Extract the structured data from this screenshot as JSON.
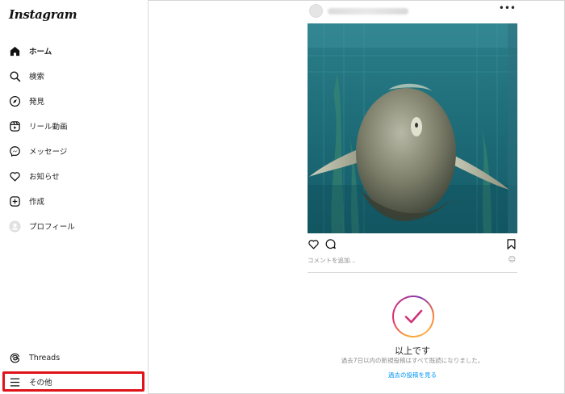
{
  "app": {
    "logo_text": "Instagram"
  },
  "sidebar": {
    "items": [
      {
        "label": "ホーム",
        "icon": "home-icon",
        "active": true
      },
      {
        "label": "検索",
        "icon": "search-icon"
      },
      {
        "label": "発見",
        "icon": "compass-icon"
      },
      {
        "label": "リール動画",
        "icon": "reels-icon"
      },
      {
        "label": "メッセージ",
        "icon": "messenger-icon"
      },
      {
        "label": "お知らせ",
        "icon": "heart-icon"
      },
      {
        "label": "作成",
        "icon": "plus-square-icon"
      },
      {
        "label": "プロフィール",
        "icon": "avatar-icon"
      }
    ],
    "threads": {
      "label": "Threads",
      "icon": "threads-icon"
    },
    "more": {
      "label": "その他",
      "icon": "hamburger-menu-icon",
      "highlight_color": "#e0131a"
    }
  },
  "post": {
    "more_icon": "more-horizontal-icon",
    "comment_placeholder": "コメントを追加...",
    "emoji_icon": "emoji-icon",
    "image_icon_name": "aquarium-sunfish-photo"
  },
  "feed_end": {
    "title": "以上です",
    "subtitle": "過去7日以内の新規投稿はすべて既読になりました。",
    "link": "過去の投稿を見る",
    "icon": "checkmark-circle-icon",
    "link_color": "#0095f6"
  }
}
